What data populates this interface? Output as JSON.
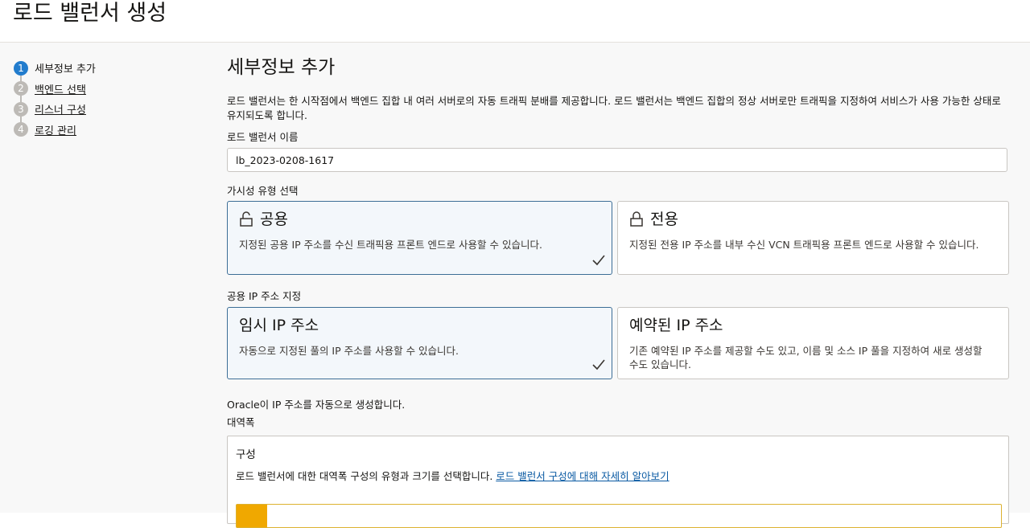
{
  "header": {
    "title": "로드 밸런서 생성"
  },
  "steps": [
    {
      "number": "1",
      "label": "세부정보 추가",
      "active": true
    },
    {
      "number": "2",
      "label": "백엔드 선택"
    },
    {
      "number": "3",
      "label": "리스너 구성"
    },
    {
      "number": "4",
      "label": "로깅 관리"
    }
  ],
  "main": {
    "title": "세부정보 추가",
    "description": "로드 밸런서는 한 시작점에서 백엔드 집합 내 여러 서버로의 자동 트래픽 분배를 제공합니다. 로드 밸런서는 백엔드 집합의 정상 서버로만 트래픽을 지정하여 서비스가 사용 가능한 상태로 유지되도록 합니다.",
    "name_label": "로드 밸런서 이름",
    "name_value": "lb_2023-0208-1617",
    "visibility_label": "가시성 유형 선택",
    "visibility": {
      "public": {
        "title": "공용",
        "desc": "지정된 공용 IP 주소를 수신 트래픽용 프론트 엔드로 사용할 수 있습니다.",
        "selected": true,
        "icon": "unlock-icon"
      },
      "private": {
        "title": "전용",
        "desc": "지정된 전용 IP 주소를 내부 수신 VCN 트래픽용 프론트 엔드로 사용할 수 있습니다.",
        "icon": "lock-icon"
      }
    },
    "ip_label": "공용 IP 주소 지정",
    "ip": {
      "ephemeral": {
        "title": "임시 IP 주소",
        "desc": "자동으로 지정된 풀의 IP 주소를 사용할 수 있습니다.",
        "selected": true
      },
      "reserved": {
        "title": "예약된 IP 주소",
        "desc": "기존 예약된 IP 주소를 제공할 수도 있고, 이름 및 소스 IP 풀을 지정하여 새로 생성할 수도 있습니다."
      }
    },
    "info_text": "Oracle이 IP 주소를 자동으로 생성합니다.",
    "bandwidth_label": "대역폭",
    "bandwidth": {
      "title": "구성",
      "desc": "로드 밸런서에 대한 대역폭 구성의 유형과 크기를 선택합니다. ",
      "link": "로드 밸런서 구성에 대해 자세히 알아보기"
    }
  },
  "colors": {
    "accent": "#227ccd",
    "selected_border": "#3d6e96",
    "link": "#0a5aa3",
    "warning": "#f0a800"
  }
}
